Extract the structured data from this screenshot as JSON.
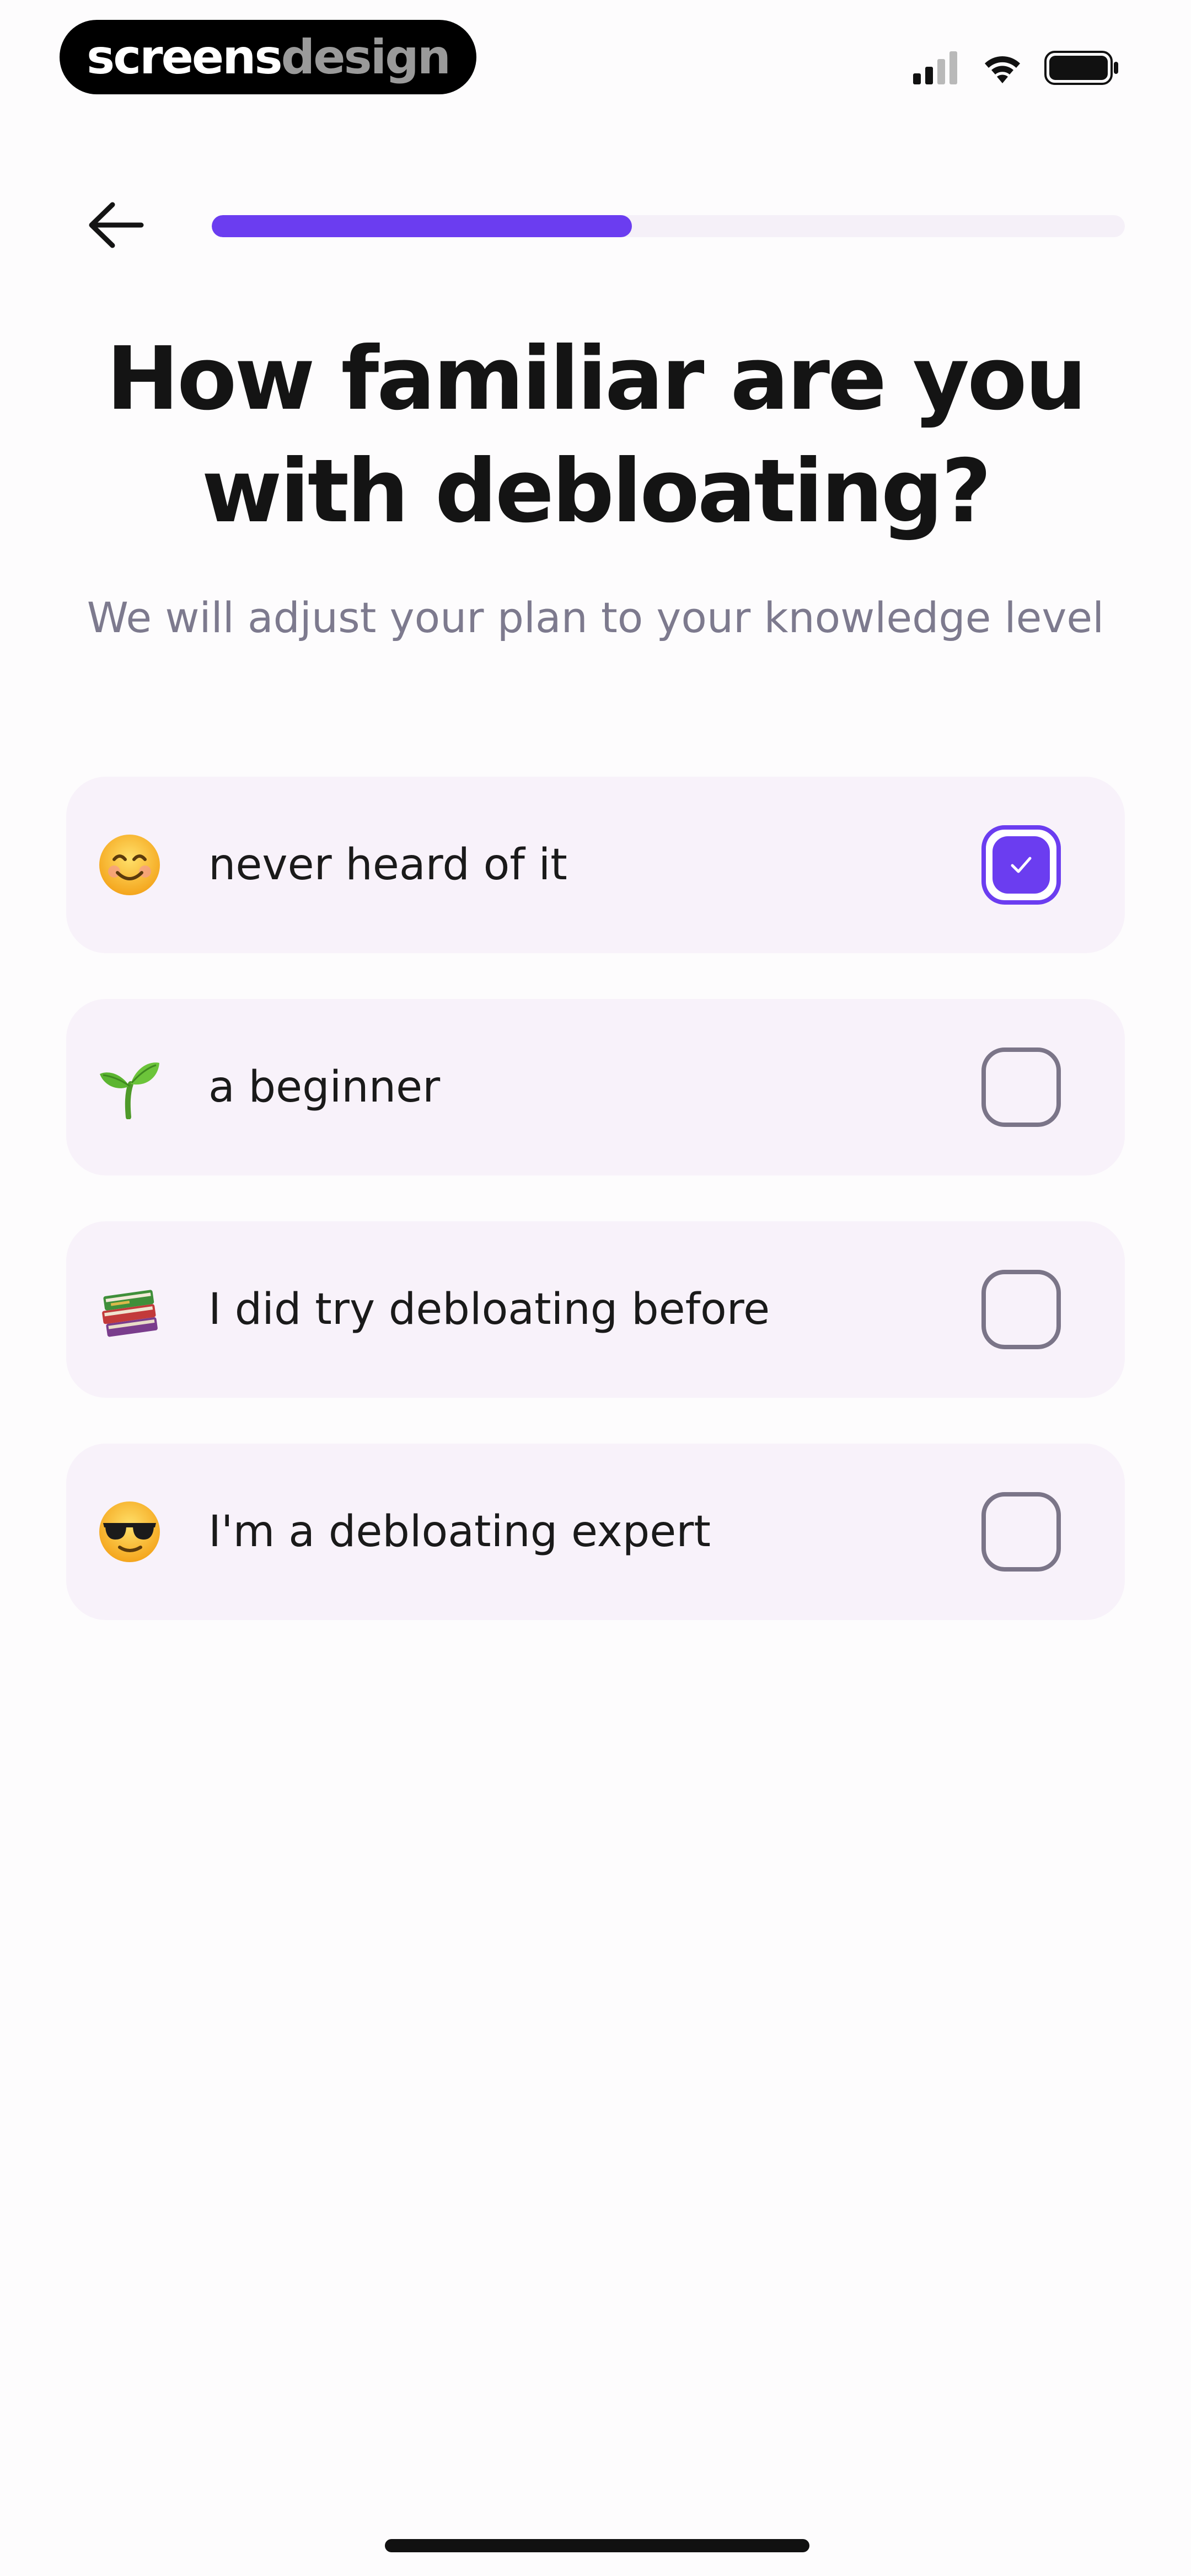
{
  "brand": {
    "part1": "screens",
    "part2": "design"
  },
  "status_bar": {
    "signal_icon": "cellular-signal-icon",
    "wifi_icon": "wifi-icon",
    "battery_icon": "battery-icon"
  },
  "nav": {
    "back_icon": "arrow-left-icon",
    "progress_fraction": 0.46
  },
  "question": {
    "title_line1": "How familiar are you",
    "title_line2": "with debloating?",
    "subtitle": "We will adjust your plan to your knowledge level"
  },
  "options": [
    {
      "emoji": "smiling-face-icon",
      "label": "never heard of it",
      "checked": true
    },
    {
      "emoji": "seedling-icon",
      "label": "a beginner",
      "checked": false
    },
    {
      "emoji": "books-icon",
      "label": "I did try debloating before",
      "checked": false
    },
    {
      "emoji": "sunglasses-face-icon",
      "label": "I'm a debloating expert",
      "checked": false
    }
  ],
  "colors": {
    "accent": "#6b3df0",
    "card_background": "#f8f2fa",
    "subtitle_text": "#7d7a8e",
    "checkbox_border": "#7b7588"
  }
}
